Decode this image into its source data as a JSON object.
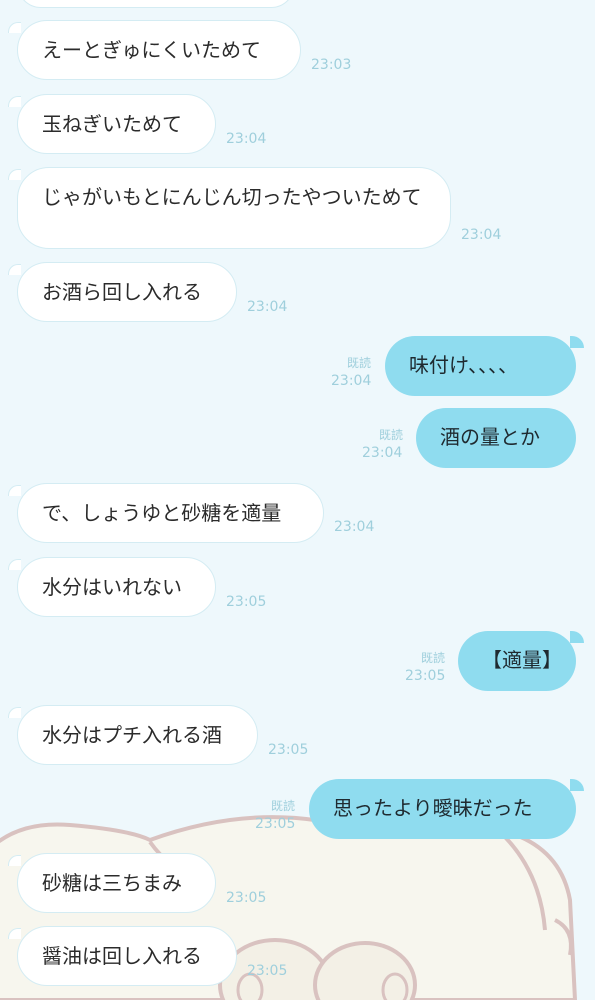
{
  "messages": [
    {
      "text": "えーとぎゅにくいためて",
      "time": "23:03"
    },
    {
      "text": "玉ねぎいためて",
      "time": "23:04"
    },
    {
      "text": "じゃがいもとにんじん切ったやついためて",
      "time": "23:04"
    },
    {
      "text": "お酒ら回し入れる",
      "time": "23:04"
    },
    {
      "text": "味付け、、、、",
      "time": "23:04",
      "read": "既読"
    },
    {
      "text": "酒の量とか",
      "time": "23:04",
      "read": "既読"
    },
    {
      "text": "で、しょうゆと砂糖を適量",
      "time": "23:04"
    },
    {
      "text": "水分はいれない",
      "time": "23:05"
    },
    {
      "text": "【適量】",
      "time": "23:05",
      "read": "既読"
    },
    {
      "text": "水分はプチ入れる酒",
      "time": "23:05"
    },
    {
      "text": "思ったより曖昧だった",
      "time": "23:05",
      "read": "既読"
    },
    {
      "text": "砂糖は三ちまみ",
      "time": "23:05"
    },
    {
      "text": "醤油は回し入れる",
      "time": "23:05"
    }
  ],
  "colors": {
    "background": "#eef8fc",
    "incoming_bubble": "#ffffff",
    "outgoing_bubble": "#8fdcef",
    "timestamp": "#9fcfdc"
  }
}
